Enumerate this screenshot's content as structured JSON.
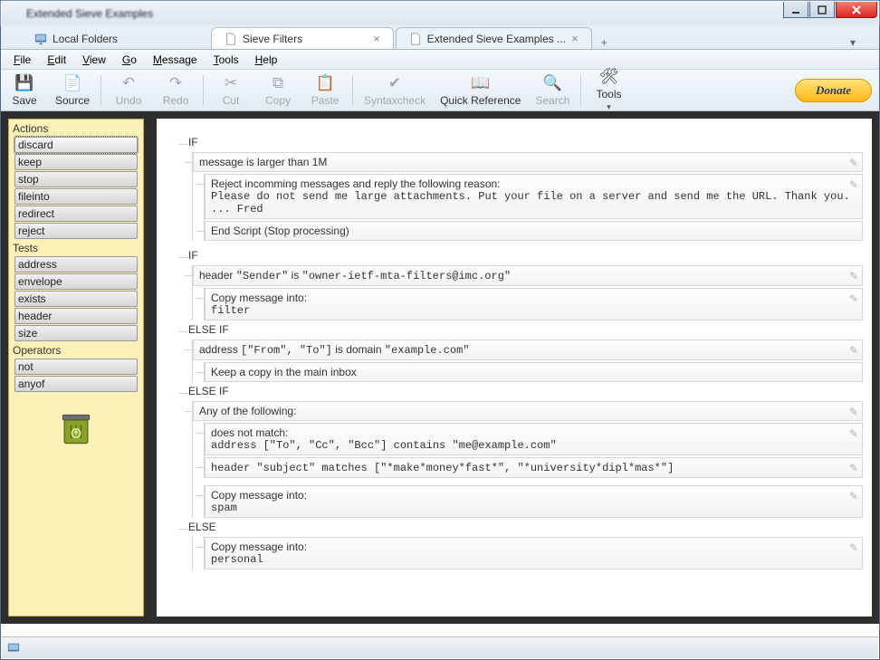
{
  "window": {
    "title": "Extended Sieve Examples"
  },
  "tabs": [
    {
      "label": "Local Folders",
      "closable": false
    },
    {
      "label": "Sieve Filters",
      "closable": true
    },
    {
      "label": "Extended Sieve Examples ...",
      "closable": true,
      "active": true
    }
  ],
  "menu": {
    "file": "File",
    "edit": "Edit",
    "view": "View",
    "go": "Go",
    "message": "Message",
    "tools": "Tools",
    "help": "Help"
  },
  "toolbar": {
    "save": "Save",
    "source": "Source",
    "undo": "Undo",
    "redo": "Redo",
    "cut": "Cut",
    "copy": "Copy",
    "paste": "Paste",
    "syntax": "Syntaxcheck",
    "quickref": "Quick Reference",
    "search": "Search",
    "tools": "Tools",
    "donate": "Donate"
  },
  "sidebar": {
    "actions_title": "Actions",
    "actions": [
      "discard",
      "keep",
      "stop",
      "fileinto",
      "redirect",
      "reject"
    ],
    "tests_title": "Tests",
    "tests": [
      "address",
      "envelope",
      "exists",
      "header",
      "size"
    ],
    "ops_title": "Operators",
    "operators": [
      "not",
      "anyof"
    ]
  },
  "script": {
    "if1": "IF",
    "if1_cond": "message is larger than 1M",
    "if1_act1_a": "Reject incomming messages and reply the following reason:",
    "if1_act1_b": "Please do not send me large attachments. Put your file on a server and send me the URL. Thank you. ... Fred",
    "if1_act2": "End Script (Stop processing)",
    "if2": "IF",
    "if2_cond_a": "header ",
    "if2_cond_b": "\"Sender\"",
    "if2_cond_c": " is ",
    "if2_cond_d": "\"owner-ietf-mta-filters@imc.org\"",
    "if2_act_a": "Copy message into:",
    "if2_act_b": "filter",
    "elif1": "ELSE IF",
    "elif1_cond_a": "address ",
    "elif1_cond_b": "[\"From\", \"To\"]",
    "elif1_cond_c": " is domain ",
    "elif1_cond_d": "\"example.com\"",
    "elif1_act": "Keep a copy in the main inbox",
    "elif2": "ELSE IF",
    "elif2_cond": "Any of the following:",
    "elif2_s1_a": "does not match:",
    "elif2_s1_b": "address [\"To\", \"Cc\", \"Bcc\"] contains \"me@example.com\"",
    "elif2_s2": "header \"subject\" matches [\"*make*money*fast*\", \"*university*dipl*mas*\"]",
    "elif2_act_a": "Copy message into:",
    "elif2_act_b": "spam",
    "else": "ELSE",
    "else_act_a": "Copy message into:",
    "else_act_b": "personal"
  }
}
